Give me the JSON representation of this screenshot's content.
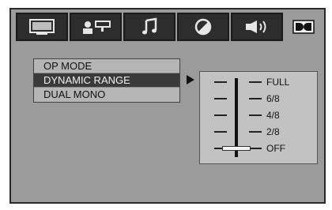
{
  "tabs": [
    {
      "name": "general",
      "icon": "tv-icon"
    },
    {
      "name": "speaker",
      "icon": "speaker-setup-icon"
    },
    {
      "name": "audio",
      "icon": "music-note-icon"
    },
    {
      "name": "video",
      "icon": "brightness-icon"
    },
    {
      "name": "sound",
      "icon": "volume-icon"
    }
  ],
  "dolby_label": "DD",
  "menu": {
    "items": [
      {
        "label": "OP MODE",
        "selected": false
      },
      {
        "label": "DYNAMIC RANGE",
        "selected": true
      },
      {
        "label": "DUAL MONO",
        "selected": false
      }
    ]
  },
  "dynamic_range": {
    "levels": [
      "FULL",
      "6/8",
      "4/8",
      "2/8",
      "OFF"
    ],
    "current": "OFF",
    "current_fraction": 0
  },
  "colors": {
    "panel": "#9b9b9b",
    "tab": "#2d2d2d",
    "selected_row": "#3a3a3a"
  }
}
